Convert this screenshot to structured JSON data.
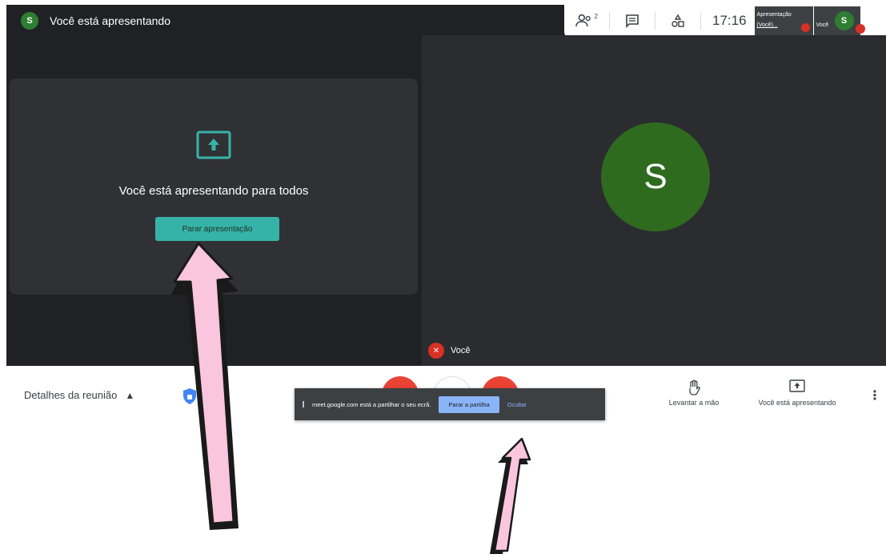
{
  "presenter_banner": {
    "avatar_initial": "S",
    "title": "Você está apresentando"
  },
  "topbar": {
    "people_count": "2",
    "time": "17:16",
    "presentation_tile": {
      "line1": "Apresentação",
      "line2": "(Você)..."
    },
    "self_tile": {
      "label": "Você",
      "avatar_initial": "S"
    }
  },
  "present_card": {
    "message": "Você está apresentando para todos",
    "stop_button": "Parar apresentação"
  },
  "participant": {
    "avatar_initial": "S",
    "name": "Você"
  },
  "bottom_bar": {
    "details": "Detalhes da reunião",
    "raise_hand": "Levantar a mão",
    "presenting": "Você está apresentando"
  },
  "share_notice": {
    "message": "meet.google.com está a partilhar o seu ecrã.",
    "stop_sharing": "Parar a partilha",
    "hide": "Ocultar"
  },
  "colors": {
    "stage": "#202124",
    "card": "#303134",
    "teal": "#36b3a8",
    "avatar_green": "#2e6b1f",
    "red": "#ea4335",
    "arrow_pink": "#f9c6de"
  },
  "icons": [
    "people-icon",
    "chat-icon",
    "activities-icon",
    "upload-screen-icon",
    "mic-off-icon",
    "shield-icon",
    "raise-hand-icon",
    "present-icon",
    "more-vert-icon",
    "chevron-up-icon"
  ]
}
